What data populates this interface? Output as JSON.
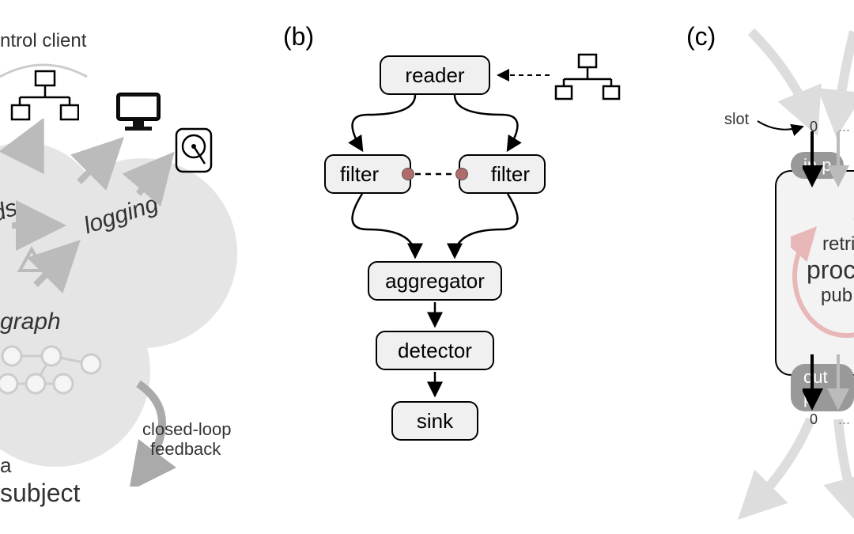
{
  "labels": {
    "panel_b": "(b)",
    "panel_c": "(c)"
  },
  "panelA": {
    "control_client": "ntrol client",
    "logging": "logging",
    "graph": "graph",
    "ds": "ds",
    "closed_loop": "closed-loop",
    "feedback": "feedback",
    "a": "a",
    "subject": "subject"
  },
  "panelB": {
    "reader": "reader",
    "filter1": "filter",
    "filter2": "filter",
    "aggregator": "aggregator",
    "detector": "detector",
    "sink": "sink"
  },
  "panelC": {
    "slot": "slot",
    "zero_top": "0",
    "dots_top": "...",
    "in_port": "in p",
    "retri": "retri",
    "proc": "proc",
    "pub": "pub",
    "out_port": "out p",
    "zero_bottom": "0",
    "dots_bottom": "..."
  }
}
